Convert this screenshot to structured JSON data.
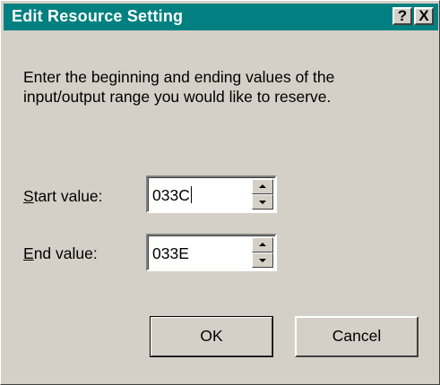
{
  "dialog": {
    "title": "Edit Resource Setting",
    "help_glyph": "?",
    "close_glyph": "X",
    "description": "Enter the beginning and ending values of the input/output range you would like to reserve.",
    "start": {
      "accel": "S",
      "label_rest": "tart value:",
      "value": "033C"
    },
    "end": {
      "accel": "E",
      "label_rest": "nd value:",
      "value": "033E"
    },
    "ok_label": "OK",
    "cancel_label": "Cancel"
  },
  "colors": {
    "titlebar": "#008080",
    "face": "#d4d0c8"
  }
}
